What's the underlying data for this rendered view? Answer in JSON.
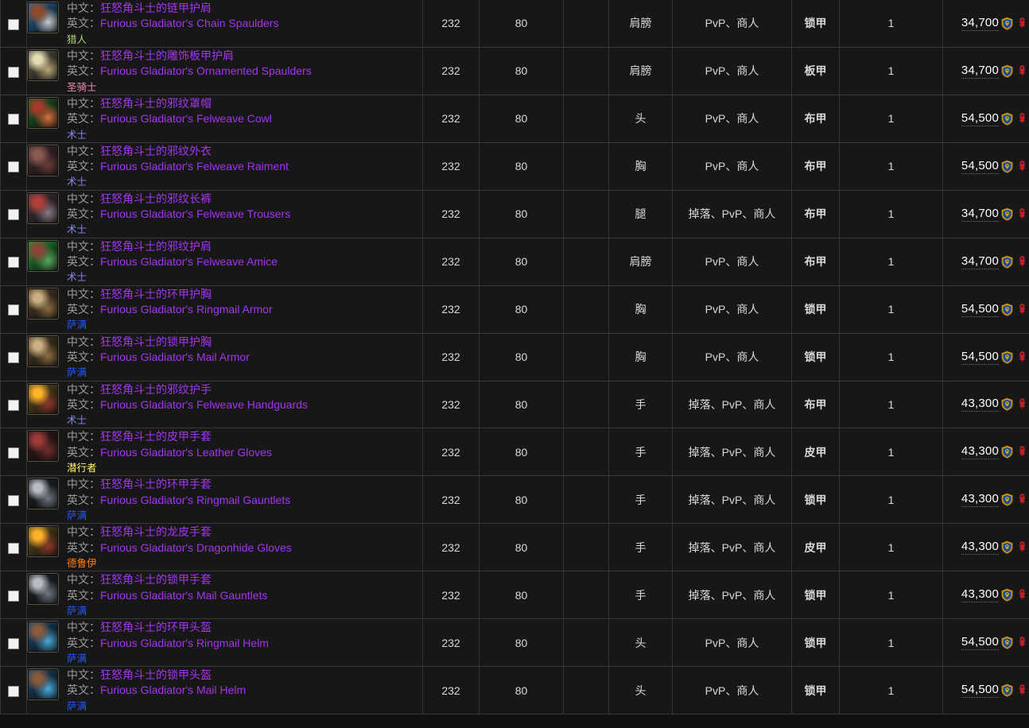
{
  "table": {
    "labels": {
      "cn": "中文：",
      "en": "英文："
    },
    "checkbox_icon": "checkbox-unchecked-icon",
    "faction_icons": [
      "alliance-crest-icon",
      "horde-crest-icon"
    ],
    "colors": {
      "item_quality_epic": "#a335ee",
      "label_gray": "#9a9a9a",
      "row_bg": "#171717",
      "border": "#3a3a3a",
      "class_hunter": "#aad372",
      "class_paladin": "#f58cba",
      "class_warlock": "#8788ee",
      "class_shaman": "#2359ff",
      "class_rogue": "#fff468",
      "class_druid": "#ff7c0a"
    },
    "rows": [
      {
        "icon": "shoulder-chain-spaulders-icon",
        "icon_a": "#2a6fa8",
        "icon_b": "#8f4a2a",
        "icon_c": "#c9cdd2",
        "name_cn": "狂怒角斗士的链甲护肩",
        "name_en": "Furious Gladiator's Chain Spaulders",
        "cls": "猎人",
        "cls_key": "hunter",
        "ilvl": "232",
        "lvl": "80",
        "blank": "",
        "slot": "肩膀",
        "source": "PvP、商人",
        "armor": "锁甲",
        "count": "1",
        "price": "34,700"
      },
      {
        "icon": "shoulder-ornamented-spaulders-icon",
        "icon_a": "#6b6450",
        "icon_b": "#e6dcb4",
        "icon_c": "#b9a878",
        "name_cn": "狂怒角斗士的雕饰板甲护肩",
        "name_en": "Furious Gladiator's Ornamented Spaulders",
        "cls": "圣骑士",
        "cls_key": "paladin",
        "ilvl": "232",
        "lvl": "80",
        "blank": "",
        "slot": "肩膀",
        "source": "PvP、商人",
        "armor": "板甲",
        "count": "1",
        "price": "34,700"
      },
      {
        "icon": "head-felweave-cowl-icon",
        "icon_a": "#1d6a2a",
        "icon_b": "#a33a2a",
        "icon_c": "#d6703c",
        "name_cn": "狂怒角斗士的邪纹罩帽",
        "name_en": "Furious Gladiator's Felweave Cowl",
        "cls": "术士",
        "cls_key": "warlock",
        "ilvl": "232",
        "lvl": "80",
        "blank": "",
        "slot": "头",
        "source": "PvP、商人",
        "armor": "布甲",
        "count": "1",
        "price": "54,500"
      },
      {
        "icon": "chest-felweave-raiment-icon",
        "icon_a": "#4a3038",
        "icon_b": "#8a5a52",
        "icon_c": "#6a3c38",
        "name_cn": "狂怒角斗士的邪纹外衣",
        "name_en": "Furious Gladiator's Felweave Raiment",
        "cls": "术士",
        "cls_key": "warlock",
        "ilvl": "232",
        "lvl": "80",
        "blank": "",
        "slot": "胸",
        "source": "PvP、商人",
        "armor": "布甲",
        "count": "1",
        "price": "54,500"
      },
      {
        "icon": "legs-felweave-trousers-icon",
        "icon_a": "#4b3a45",
        "icon_b": "#b04038",
        "icon_c": "#8d7a86",
        "name_cn": "狂怒角斗士的邪纹长裤",
        "name_en": "Furious Gladiator's Felweave Trousers",
        "cls": "术士",
        "cls_key": "warlock",
        "ilvl": "232",
        "lvl": "80",
        "blank": "",
        "slot": "腿",
        "source": "掉落、PvP、商人",
        "armor": "布甲",
        "count": "1",
        "price": "34,700"
      },
      {
        "icon": "shoulder-felweave-amice-icon",
        "icon_a": "#1fa33a",
        "icon_b": "#8d4438",
        "icon_c": "#59a85c",
        "name_cn": "狂怒角斗士的邪纹护肩",
        "name_en": "Furious Gladiator's Felweave Amice",
        "cls": "术士",
        "cls_key": "warlock",
        "ilvl": "232",
        "lvl": "80",
        "blank": "",
        "slot": "肩膀",
        "source": "PvP、商人",
        "armor": "布甲",
        "count": "1",
        "price": "34,700"
      },
      {
        "icon": "chest-ringmail-armor-icon",
        "icon_a": "#5a4428",
        "icon_b": "#cbb083",
        "icon_c": "#8a6c40",
        "name_cn": "狂怒角斗士的环甲护胸",
        "name_en": "Furious Gladiator's Ringmail Armor",
        "cls": "萨满",
        "cls_key": "shaman",
        "ilvl": "232",
        "lvl": "80",
        "blank": "",
        "slot": "胸",
        "source": "PvP、商人",
        "armor": "锁甲",
        "count": "1",
        "price": "54,500"
      },
      {
        "icon": "chest-mail-armor-icon",
        "icon_a": "#5a4428",
        "icon_b": "#cbb083",
        "icon_c": "#8a6c40",
        "name_cn": "狂怒角斗士的锁甲护胸",
        "name_en": "Furious Gladiator's Mail Armor",
        "cls": "萨满",
        "cls_key": "shaman",
        "ilvl": "232",
        "lvl": "80",
        "blank": "",
        "slot": "胸",
        "source": "PvP、商人",
        "armor": "锁甲",
        "count": "1",
        "price": "54,500"
      },
      {
        "icon": "hands-felweave-handguards-icon",
        "icon_a": "#6b5a22",
        "icon_b": "#ffb228",
        "icon_c": "#8c3a2a",
        "name_cn": "狂怒角斗士的邪纹护手",
        "name_en": "Furious Gladiator's Felweave Handguards",
        "cls": "术士",
        "cls_key": "warlock",
        "ilvl": "232",
        "lvl": "80",
        "blank": "",
        "slot": "手",
        "source": "掉落、PvP、商人",
        "armor": "布甲",
        "count": "1",
        "price": "43,300"
      },
      {
        "icon": "hands-leather-gloves-icon",
        "icon_a": "#3a1a1c",
        "icon_b": "#9e3a38",
        "icon_c": "#6e2c2c",
        "name_cn": "狂怒角斗士的皮甲手套",
        "name_en": "Furious Gladiator's Leather Gloves",
        "cls": "潜行者",
        "cls_key": "rogue",
        "ilvl": "232",
        "lvl": "80",
        "blank": "",
        "slot": "手",
        "source": "掉落、PvP、商人",
        "armor": "皮甲",
        "count": "1",
        "price": "43,300"
      },
      {
        "icon": "hands-ringmail-gauntlets-icon",
        "icon_a": "#22242a",
        "icon_b": "#b9bdc6",
        "icon_c": "#6f7682",
        "name_cn": "狂怒角斗士的环甲手套",
        "name_en": "Furious Gladiator's Ringmail Gauntlets",
        "cls": "萨满",
        "cls_key": "shaman",
        "ilvl": "232",
        "lvl": "80",
        "blank": "",
        "slot": "手",
        "source": "掉落、PvP、商人",
        "armor": "锁甲",
        "count": "1",
        "price": "43,300"
      },
      {
        "icon": "hands-dragonhide-gloves-icon",
        "icon_a": "#6b5a22",
        "icon_b": "#ffb228",
        "icon_c": "#8c3a2a",
        "name_cn": "狂怒角斗士的龙皮手套",
        "name_en": "Furious Gladiator's Dragonhide Gloves",
        "cls": "德鲁伊",
        "cls_key": "druid",
        "ilvl": "232",
        "lvl": "80",
        "blank": "",
        "slot": "手",
        "source": "掉落、PvP、商人",
        "armor": "皮甲",
        "count": "1",
        "price": "43,300"
      },
      {
        "icon": "hands-mail-gauntlets-icon",
        "icon_a": "#22242a",
        "icon_b": "#b9bdc6",
        "icon_c": "#6f7682",
        "name_cn": "狂怒角斗士的锁甲手套",
        "name_en": "Furious Gladiator's Mail Gauntlets",
        "cls": "萨满",
        "cls_key": "shaman",
        "ilvl": "232",
        "lvl": "80",
        "blank": "",
        "slot": "手",
        "source": "掉落、PvP、商人",
        "armor": "锁甲",
        "count": "1",
        "price": "43,300"
      },
      {
        "icon": "head-ringmail-helm-icon",
        "icon_a": "#1a4f7a",
        "icon_b": "#8a5a3c",
        "icon_c": "#4aa8d8",
        "name_cn": "狂怒角斗士的环甲头盔",
        "name_en": "Furious Gladiator's Ringmail Helm",
        "cls": "萨满",
        "cls_key": "shaman",
        "ilvl": "232",
        "lvl": "80",
        "blank": "",
        "slot": "头",
        "source": "PvP、商人",
        "armor": "锁甲",
        "count": "1",
        "price": "54,500"
      },
      {
        "icon": "head-mail-helm-icon",
        "icon_a": "#1a4f7a",
        "icon_b": "#8a5a3c",
        "icon_c": "#4aa8d8",
        "name_cn": "狂怒角斗士的锁甲头盔",
        "name_en": "Furious Gladiator's Mail Helm",
        "cls": "萨满",
        "cls_key": "shaman",
        "ilvl": "232",
        "lvl": "80",
        "blank": "",
        "slot": "头",
        "source": "PvP、商人",
        "armor": "锁甲",
        "count": "1",
        "price": "54,500"
      }
    ]
  }
}
